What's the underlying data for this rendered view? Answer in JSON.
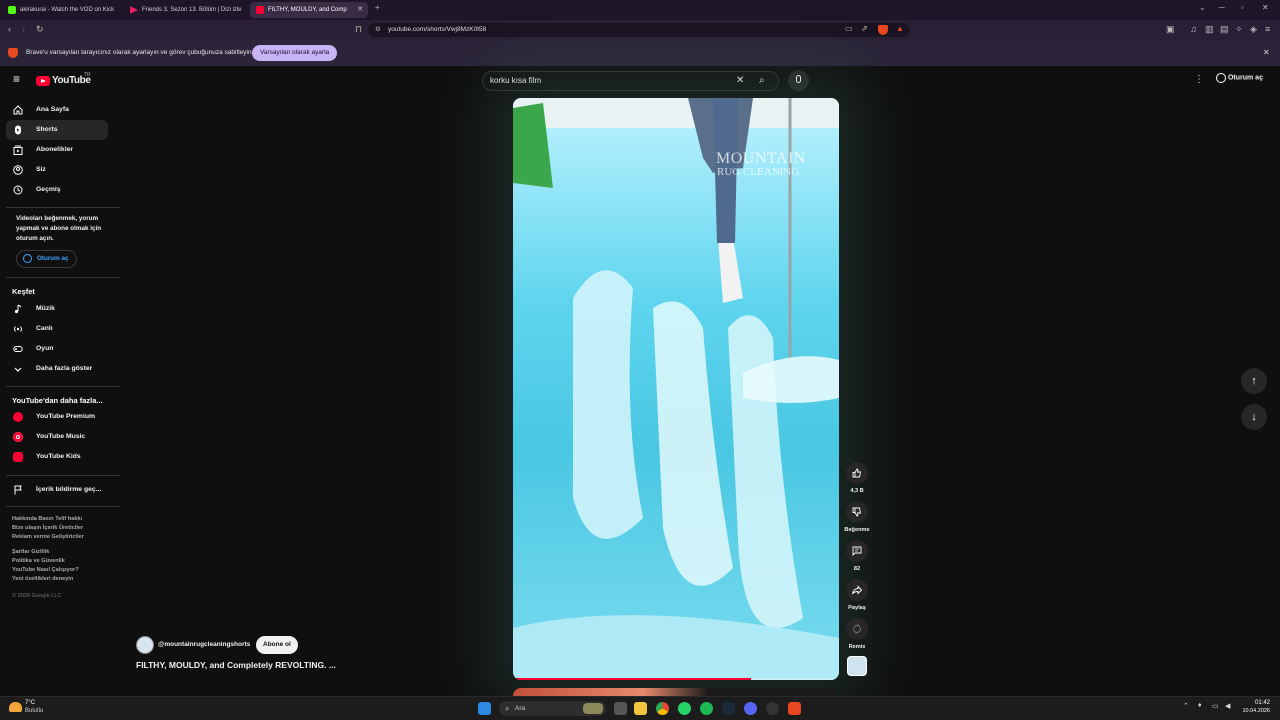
{
  "browser": {
    "tabs": [
      {
        "title": "akirakurai - Watch the VOD on Kick",
        "color": "#53fc18"
      },
      {
        "title": "Friends 3. Sezon 13. Bölüm | Dizi izle",
        "color": "#e91e63"
      },
      {
        "title": "FILTHY, MOULDY, and Comp",
        "color": "#ff0033",
        "active": true
      }
    ],
    "new_tab": "+",
    "url": "youtube.com/shorts/Vwj8MzK0t58",
    "notice": {
      "text": "Brave'u varsayılan tarayıcınız olarak ayarlayın ve görev çubuğunuza sabitleyin",
      "button": "Varsayılan olarak ayarla"
    }
  },
  "header": {
    "logo": "YouTube",
    "region": "TR",
    "search_value": "korku kısa film",
    "sign_in": "Oturum aç"
  },
  "sidebar": {
    "main": [
      {
        "label": "Ana Sayfa",
        "icon": "home-icon"
      },
      {
        "label": "Shorts",
        "icon": "shorts-icon",
        "active": true
      },
      {
        "label": "Abonelikler",
        "icon": "subscriptions-icon"
      },
      {
        "label": "Siz",
        "icon": "you-icon"
      },
      {
        "label": "Geçmiş",
        "icon": "history-icon"
      }
    ],
    "signin_prompt": "Videoları beğenmek, yorum yapmak ve abone olmak için oturum açın.",
    "signin_button": "Oturum aç",
    "explore_title": "Keşfet",
    "explore": [
      {
        "label": "Müzik",
        "icon": "music-icon"
      },
      {
        "label": "Canlı",
        "icon": "live-icon"
      },
      {
        "label": "Oyun",
        "icon": "gaming-icon"
      },
      {
        "label": "Daha fazla göster",
        "icon": "chevron-down-icon"
      }
    ],
    "more_title": "YouTube'dan daha fazla...",
    "more": [
      {
        "label": "YouTube Premium"
      },
      {
        "label": "YouTube Music"
      },
      {
        "label": "YouTube Kids"
      }
    ],
    "report": "İçerik bildirme geç...",
    "footer1": [
      "Hakkında  Basın  Telif hakkı",
      "Bize ulaşın  İçerik Üreticiler",
      "Reklam verme  Geliştiriciler"
    ],
    "footer2": [
      "Şartlar  Gizlilik",
      "Politika ve Güvenlik",
      "YouTube Nasıl Çalışıyor?",
      "Yeni özellikleri deneyin"
    ],
    "copyright": "© 2026 Google LLC"
  },
  "video": {
    "channel": "@mountainrugcleaningshorts",
    "subscribe": "Abone ol",
    "title": "FILTHY, MOULDY, and Completely REVOLTING. ...",
    "watermark_line1": "MOUNTAIN",
    "watermark_line2": "RUG CLEANING",
    "progress": 0.73
  },
  "actions": {
    "likes": "4,3 B",
    "dislike": "Beğenme",
    "comments": "82",
    "share": "Paylaş",
    "remix": "Remix"
  },
  "taskbar": {
    "temp": "7°C",
    "weather": "Bulutlu",
    "search": "Ara",
    "time": "01:42",
    "date": "10.04.2026"
  }
}
